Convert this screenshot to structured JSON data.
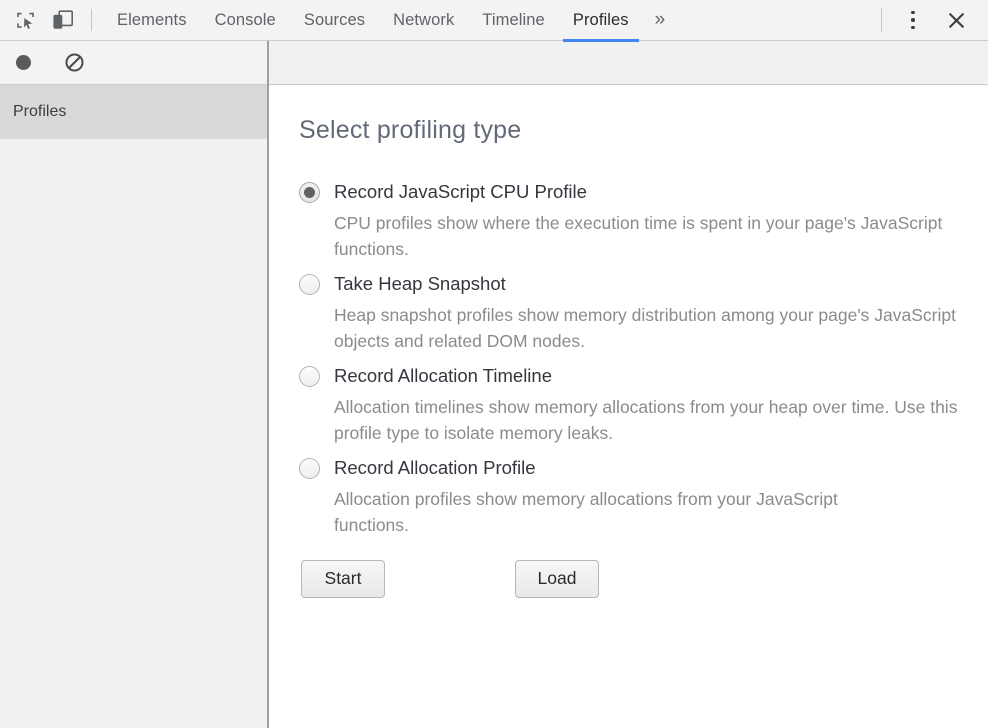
{
  "tabbar": {
    "inspect_icon": "inspect-element-icon",
    "device_icon": "device-toolbar-icon",
    "tabs": [
      {
        "label": "Elements",
        "active": false
      },
      {
        "label": "Console",
        "active": false
      },
      {
        "label": "Sources",
        "active": false
      },
      {
        "label": "Network",
        "active": false
      },
      {
        "label": "Timeline",
        "active": false
      },
      {
        "label": "Profiles",
        "active": true
      }
    ],
    "more_tabs": "»",
    "menu_icon": "more-options-kebab-icon",
    "close_icon": "close-icon",
    "active_tab_underline_color": "#4285f4"
  },
  "sidebar": {
    "toolbar": {
      "record_icon": "record-circle-icon",
      "clear_icon": "clear-prohibited-icon"
    },
    "items": [
      {
        "label": "Profiles",
        "selected": true
      }
    ],
    "selected_background": "#d9d9d9"
  },
  "main": {
    "title": "Select profiling type",
    "options": [
      {
        "label": "Record JavaScript CPU Profile",
        "description": "CPU profiles show where the execution time is spent in your page's JavaScript functions.",
        "selected": true
      },
      {
        "label": "Take Heap Snapshot",
        "description": "Heap snapshot profiles show memory distribution among your page's JavaScript objects and related DOM nodes.",
        "selected": false
      },
      {
        "label": "Record Allocation Timeline",
        "description": "Allocation timelines show memory allocations from your heap over time. Use this profile type to isolate memory leaks.",
        "selected": false
      },
      {
        "label": "Record Allocation Profile",
        "description": "Allocation profiles show memory allocations from your JavaScript functions.",
        "selected": false
      }
    ],
    "buttons": {
      "start": "Start",
      "load": "Load"
    }
  }
}
